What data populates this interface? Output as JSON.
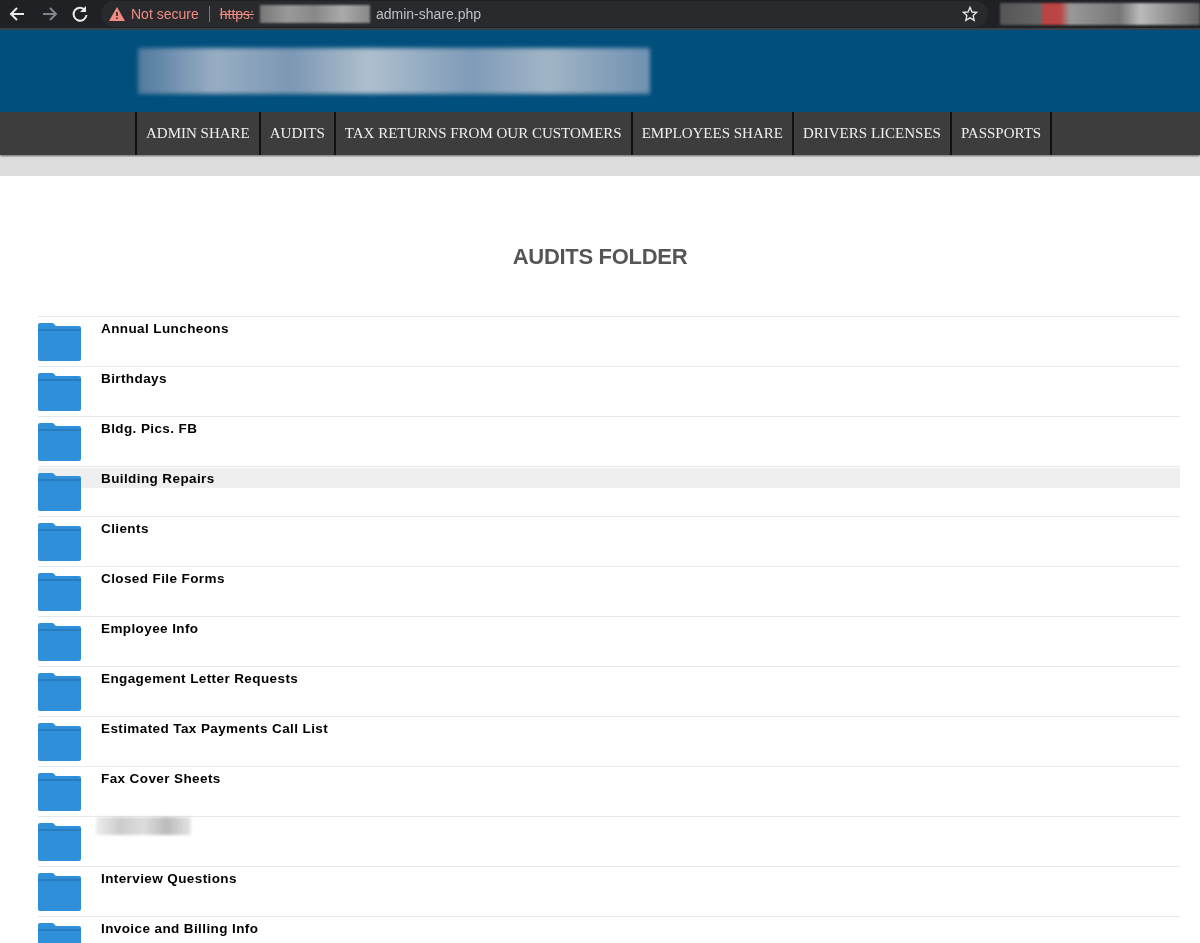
{
  "browser": {
    "security_warning": "Not secure",
    "url_scheme": "https:",
    "url_path": "admin-share.php"
  },
  "nav": [
    {
      "label": "ADMIN SHARE",
      "selected": false
    },
    {
      "label": "AUDITS",
      "selected": false
    },
    {
      "label": "TAX RETURNS FROM OUR CUSTOMERS",
      "selected": false
    },
    {
      "label": "EMPLOYEES SHARE",
      "selected": false
    },
    {
      "label": "DRIVERS LICENSES",
      "selected": false
    },
    {
      "label": "PASSPORTS",
      "selected": false
    }
  ],
  "title": "AUDITS FOLDER",
  "folders": [
    {
      "name": "Annual Luncheons",
      "highlighted": false
    },
    {
      "name": "Birthdays",
      "highlighted": false
    },
    {
      "name": "Bldg. Pics. FB",
      "highlighted": false
    },
    {
      "name": "Building Repairs",
      "highlighted": true
    },
    {
      "name": "Clients",
      "highlighted": false
    },
    {
      "name": "Closed File Forms",
      "highlighted": false
    },
    {
      "name": "Employee Info",
      "highlighted": false
    },
    {
      "name": "Engagement Letter Requests",
      "highlighted": false
    },
    {
      "name": "Estimated Tax Payments Call List",
      "highlighted": false
    },
    {
      "name": "Fax Cover Sheets",
      "highlighted": false
    },
    {
      "kind": "redacted",
      "highlighted": false
    },
    {
      "name": "Interview Questions",
      "highlighted": false
    },
    {
      "name": "Invoice and Billing Info",
      "highlighted": false
    }
  ]
}
